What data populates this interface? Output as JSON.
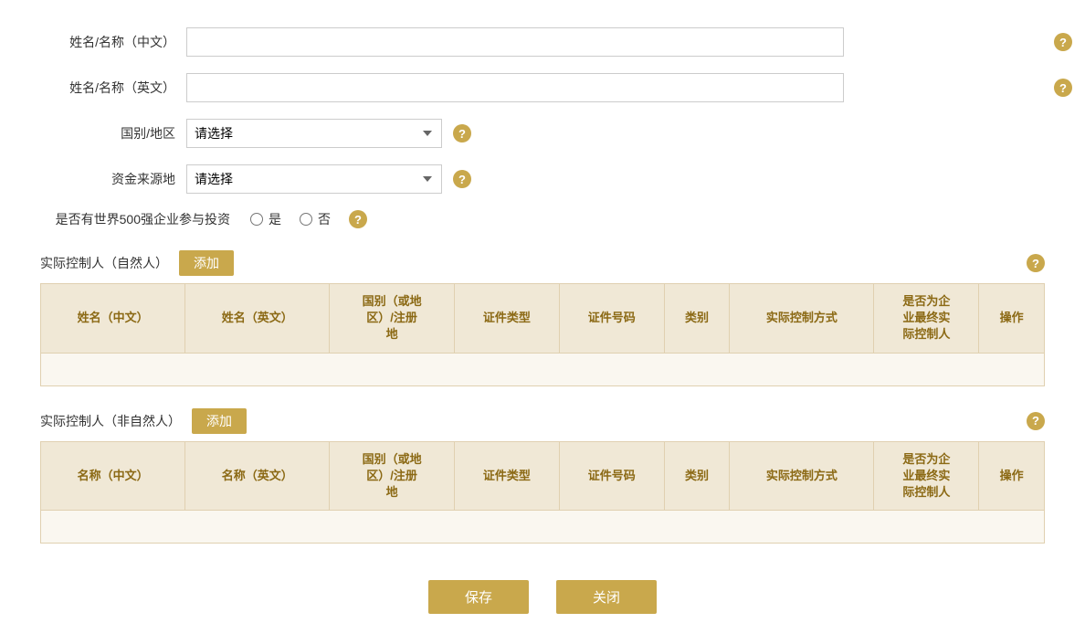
{
  "form": {
    "name_zh_label": "姓名/名称（中文）",
    "name_en_label": "姓名/名称（英文）",
    "country_label": "国别/地区",
    "fund_source_label": "资金来源地",
    "fortune500_label": "是否有世界500强企业参与投资",
    "country_placeholder": "请选择",
    "fund_source_placeholder": "请选择",
    "radio_yes": "是",
    "radio_no": "否"
  },
  "natural_person_section": {
    "title": "实际控制人（自然人）",
    "add_label": "添加",
    "columns": [
      "姓名（中文）",
      "姓名（英文）",
      "国别（或地区）/注册地",
      "证件类型",
      "证件号码",
      "类别",
      "实际控制方式",
      "是否为企业最终实际控制人",
      "操作"
    ]
  },
  "non_natural_person_section": {
    "title": "实际控制人（非自然人）",
    "add_label": "添加",
    "columns": [
      "名称（中文）",
      "名称（英文）",
      "国别（或地区）/注册地",
      "证件类型",
      "证件号码",
      "类别",
      "实际控制方式",
      "是否为企业最终实际控制人",
      "操作"
    ]
  },
  "buttons": {
    "save": "保存",
    "close": "关闭"
  },
  "help_icon": "?",
  "colors": {
    "gold": "#c9a84c",
    "table_header_bg": "#f0e8d6",
    "table_header_text": "#8b6914"
  }
}
